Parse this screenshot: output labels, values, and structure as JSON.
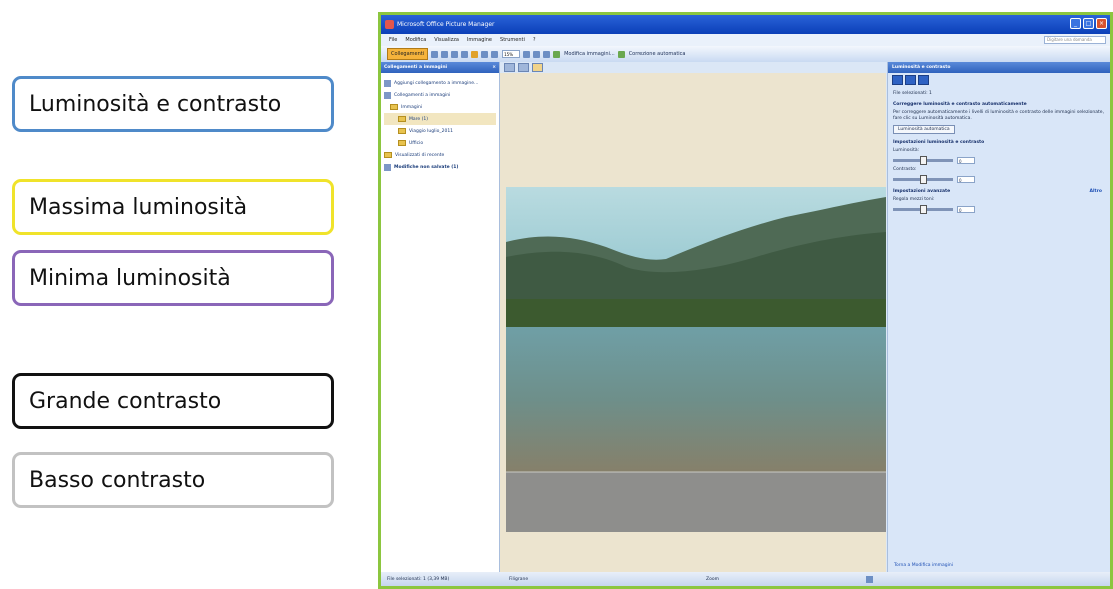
{
  "callouts": {
    "luminosita_contrasto": "Luminosità e contrasto",
    "massima_luminosita": "Massima luminosità",
    "minima_luminosita": "Minima luminosità",
    "grande_contrasto": "Grande contrasto",
    "basso_contrasto": "Basso contrasto"
  },
  "window": {
    "title": "Microsoft Office Picture Manager",
    "menu": [
      "File",
      "Modifica",
      "Visualizza",
      "Immagine",
      "Strumenti",
      "?"
    ],
    "help_placeholder": "Digitare una domanda",
    "toolbar": {
      "shortcuts_label": "Collegamenti",
      "zoom_value": "15%",
      "edit_pictures_label": "Modifica immagini...",
      "auto_correct_label": "Correzione automatica"
    },
    "left_pane": {
      "header": "Collegamenti a immagini",
      "add_shortcut": "Aggiungi collegamento a immagine...",
      "tree": [
        {
          "label": "Collegamenti a immagini"
        },
        {
          "label": "Immagini"
        },
        {
          "label": "Mare (1)"
        },
        {
          "label": "Viaggio luglio_2011"
        },
        {
          "label": "Ufficio"
        },
        {
          "label": "Visualizzati di recente"
        },
        {
          "label": "Modifiche non salvate (1)"
        }
      ]
    },
    "right_pane": {
      "header": "Luminosità e contrasto",
      "files_selected": "File selezionati: 1",
      "auto_section_title": "Correggere luminosità e contrasto automaticamente",
      "auto_section_text": "Per correggere automaticamente i livelli di luminosità e contrasto delle immagini selezionate, fare clic su Luminosità automatica.",
      "auto_button": "Luminosità automatica",
      "settings_title": "Impostazioni luminosità e contrasto",
      "brightness_label": "Luminosità:",
      "brightness_value": "0",
      "contrast_label": "Contrasto:",
      "contrast_value": "0",
      "advanced_title": "Impostazioni avanzate",
      "advanced_more": "Altro",
      "midtone_label": "Regola mezzi toni:",
      "midtone_value": "0",
      "footer_link": "Torna a Modifica immagini"
    },
    "status": {
      "selected": "File selezionati: 1 (3,39 MB)",
      "filmstrip": "Filigrane",
      "zoom": "Zoom"
    }
  },
  "colors": {
    "callout_lum": "#4f8ac9",
    "callout_max": "#f0e32a",
    "callout_min": "#8a66b8",
    "callout_gc": "#111111",
    "callout_bc": "#c2c2c2",
    "window_border": "#8cc63f"
  },
  "sliders": {
    "brightness": 0.5,
    "contrast": 0.5,
    "midtone": 0.5
  }
}
